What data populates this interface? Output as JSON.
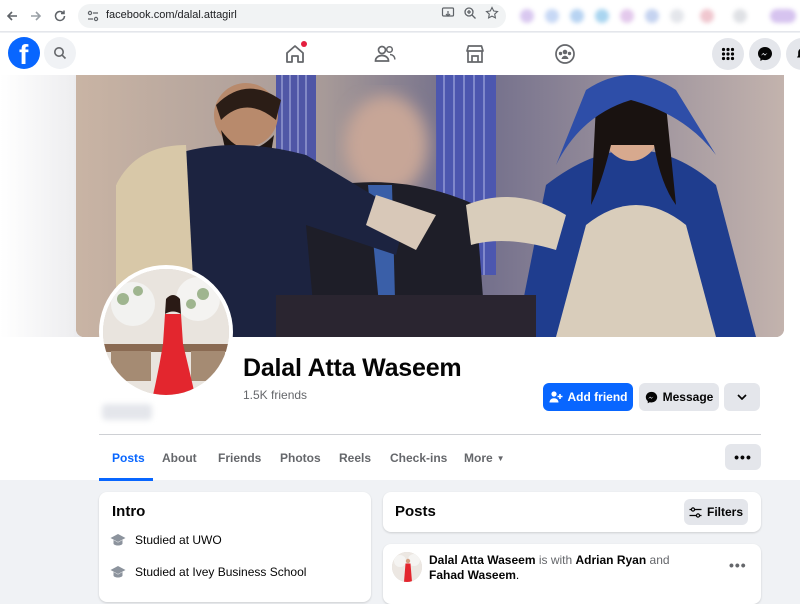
{
  "browser": {
    "url": "facebook.com/dalal.attagirl",
    "back_icon": "arrow-left-icon",
    "forward_icon": "arrow-right-icon",
    "reload_icon": "reload-icon"
  },
  "header": {
    "logo": "f",
    "icons": [
      "search-icon",
      "home-icon",
      "friends-icon",
      "marketplace-icon",
      "groups-icon",
      "apps-grid-icon",
      "messenger-icon",
      "notifications-icon"
    ],
    "accent": "#0866ff",
    "notification_dot_color": "#e41e3f"
  },
  "profile": {
    "name": "Dalal Atta Waseem",
    "friends": "1.5K friends",
    "add_friend_label": "Add friend",
    "message_label": "Message"
  },
  "tabs": [
    {
      "label": "Posts",
      "active": true
    },
    {
      "label": "About"
    },
    {
      "label": "Friends"
    },
    {
      "label": "Photos"
    },
    {
      "label": "Reels"
    },
    {
      "label": "Check-ins"
    },
    {
      "label": "More"
    }
  ],
  "intro": {
    "title": "Intro",
    "items": [
      {
        "prefix": "Studied at ",
        "place": "UWO",
        "icon": "graduation-cap-icon"
      },
      {
        "prefix": "Studied at ",
        "place": "Ivey Business School",
        "icon": "graduation-cap-icon"
      }
    ]
  },
  "posts": {
    "title": "Posts",
    "filters_label": "Filters",
    "first_post": {
      "author": "Dalal Atta Waseem",
      "is_with": " is with ",
      "person1": "Adrian Ryan",
      "and": " and ",
      "person2": "Fahad Waseem",
      "end": "."
    }
  }
}
